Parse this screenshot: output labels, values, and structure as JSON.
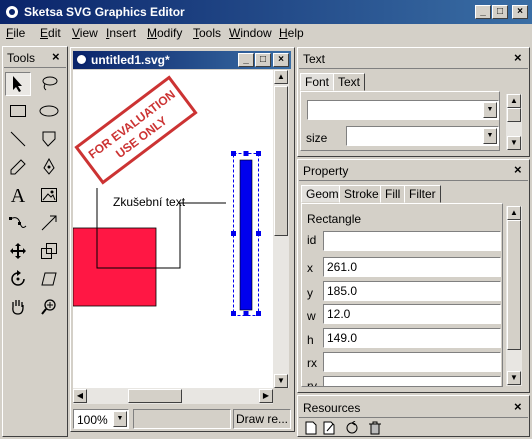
{
  "window": {
    "title": "Sketsa SVG Graphics Editor",
    "minimize": "_",
    "maximize": "□",
    "close": "×"
  },
  "menu": [
    "File",
    "Edit",
    "View",
    "Insert",
    "Modify",
    "Tools",
    "Window",
    "Help"
  ],
  "tools_panel": {
    "title": "Tools",
    "close": "×",
    "tools": [
      "select-arrow",
      "lasso",
      "rectangle",
      "ellipse",
      "line",
      "polygon",
      "pencil",
      "pen",
      "text",
      "image",
      "node-edit",
      "transform",
      "move",
      "scale",
      "rotate",
      "skew",
      "pan",
      "zoom"
    ],
    "text_tool_glyph": "A"
  },
  "document": {
    "title": "untitled1.svg*",
    "watermark_line1": "FOR EVALUATION",
    "watermark_line2": "USE ONLY",
    "sample_text": "Zkušební text",
    "zoom": "100%",
    "status": "Draw re..."
  },
  "text_panel": {
    "title": "Text",
    "close": "×",
    "tabs": [
      "Font",
      "Text"
    ],
    "size_label": "size"
  },
  "property_panel": {
    "title": "Property",
    "close": "×",
    "tabs": [
      "Geom",
      "Stroke",
      "Fill",
      "Filter"
    ],
    "section": "Rectangle",
    "fields": [
      {
        "label": "id",
        "value": ""
      },
      {
        "label": "x",
        "value": "261.0"
      },
      {
        "label": "y",
        "value": "185.0"
      },
      {
        "label": "w",
        "value": "12.0"
      },
      {
        "label": "h",
        "value": "149.0"
      },
      {
        "label": "rx",
        "value": ""
      },
      {
        "label": "ry",
        "value": ""
      }
    ]
  },
  "resources_panel": {
    "title": "Resources",
    "close": "×"
  },
  "colors": {
    "titlebar_start": "#0a246a",
    "titlebar_end": "#3a6ea5",
    "face": "#d4d0c8",
    "red_rect": "#ff1744",
    "blue_rect": "#0000ee",
    "watermark": "#cc3333"
  }
}
